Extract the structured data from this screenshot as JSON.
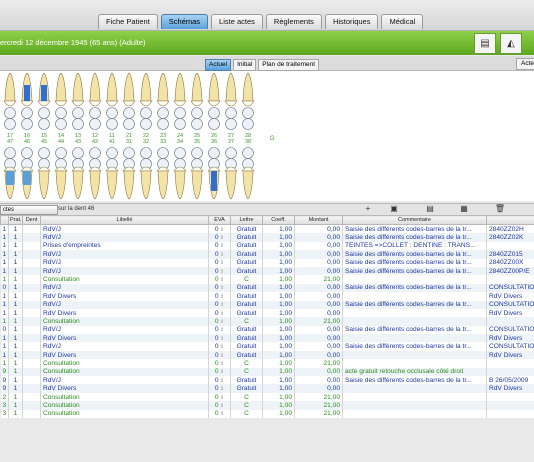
{
  "tabs": [
    "Fiche Patient",
    "Schémas",
    "Liste actes",
    "Règlements",
    "Historiques",
    "Médical"
  ],
  "active_tab": "Schémas",
  "patient_line": "ercredi 12 décembre 1945 (65 ans)  (Adulte)",
  "subtabs": [
    "Actuel",
    "Initial",
    "Plan de traitement"
  ],
  "active_subtab": "Actuel",
  "acte_button": "Acte",
  "upper_numbers": [
    "17",
    "16",
    "15",
    "14",
    "13",
    "12",
    "11",
    "21",
    "22",
    "23",
    "24",
    "25",
    "26",
    "27",
    "28"
  ],
  "upper_numbers_row2": [
    "47",
    "46",
    "45",
    "44",
    "43",
    "42",
    "41",
    "31",
    "32",
    "33",
    "34",
    "35",
    "36",
    "37",
    "38"
  ],
  "quadrant_label": "G",
  "filter_select": "ctes",
  "filter_text": "sur la dent 46",
  "table_headers": [
    "Prat.",
    "Dent",
    "Libellé",
    "EVA",
    "Lettre",
    "Coeff.",
    "Montant",
    "Commentaire",
    ""
  ],
  "rows": [
    [
      "1",
      "1",
      "",
      "RdV/J",
      "0",
      "Gratuit",
      "1,00",
      "0,00",
      "Saisie des différents codes-barres de la tr...",
      "2840ZZ02H",
      "blue"
    ],
    [
      "1",
      "1",
      "",
      "RdV/J",
      "0",
      "Gratuit",
      "1,00",
      "0,00",
      "Saisie des différents codes-barres de la tr...",
      "2840ZZ02K",
      "blue"
    ],
    [
      "1",
      "1",
      "",
      "Prises d'empreintes",
      "0",
      "Gratuit",
      "1,00",
      "0,00",
      "TEINTES =>COLLET : DENTINE : TRANS...",
      "",
      "blue"
    ],
    [
      "1",
      "1",
      "",
      "RdV/J",
      "0",
      "Gratuit",
      "1,00",
      "0,00",
      "Saisie des différents codes-barres de la tr...",
      "2840ZZ015",
      "blue"
    ],
    [
      "1",
      "1",
      "",
      "RdV/J",
      "0",
      "Gratuit",
      "1,00",
      "0,00",
      "Saisie des différents codes-barres de la tr...",
      "2840ZZ00X",
      "blue"
    ],
    [
      "1",
      "1",
      "",
      "RdV/J",
      "0",
      "Gratuit",
      "1,00",
      "0,00",
      "Saisie des différents codes-barres de la tr...",
      "2840ZZ00P/E",
      "blue"
    ],
    [
      "1",
      "1",
      "",
      "Consultation",
      "0",
      "C",
      "1,00",
      "21,00",
      "",
      "",
      "green"
    ],
    [
      "0",
      "1",
      "",
      "RdV/J",
      "0",
      "Gratuit",
      "1,00",
      "0,00",
      "Saisie des différents codes-barres de la tr...",
      "CONSULTATION",
      "blue"
    ],
    [
      "1",
      "1",
      "",
      "RdV Divers",
      "0",
      "Gratuit",
      "1,00",
      "0,00",
      "",
      "RdV Divers",
      "blue"
    ],
    [
      "1",
      "1",
      "",
      "RdV/J",
      "0",
      "Gratuit",
      "1,00",
      "0,00",
      "Saisie des différents codes-barres de la tr...",
      "CONSULTATION",
      "blue"
    ],
    [
      "1",
      "1",
      "",
      "RdV Divers",
      "0",
      "Gratuit",
      "1,00",
      "0,00",
      "",
      "RdV Divers",
      "blue"
    ],
    [
      "1",
      "1",
      "",
      "Consultation",
      "0",
      "C",
      "1,00",
      "21,00",
      "",
      "",
      "green"
    ],
    [
      "0",
      "1",
      "",
      "RdV/J",
      "0",
      "Gratuit",
      "1,00",
      "0,00",
      "Saisie des différents codes-barres de la tr...",
      "CONSULTATION",
      "blue"
    ],
    [
      "1",
      "1",
      "",
      "RdV Divers",
      "0",
      "Gratuit",
      "1,00",
      "0,00",
      "",
      "RdV Divers",
      "blue"
    ],
    [
      "1",
      "1",
      "",
      "RdV/J",
      "0",
      "Gratuit",
      "1,00",
      "0,00",
      "Saisie des différents codes-barres de la tr...",
      "CONSULTATION",
      "blue"
    ],
    [
      "1",
      "1",
      "",
      "RdV Divers",
      "0",
      "Gratuit",
      "1,00",
      "0,00",
      "",
      "RdV Divers",
      "blue"
    ],
    [
      "1",
      "1",
      "",
      "Consultation",
      "0",
      "C",
      "1,00",
      "21,00",
      "",
      "",
      "green"
    ],
    [
      "9",
      "1",
      "",
      "Consultation",
      "0",
      "C",
      "1,00",
      "0,00",
      "acte gratuit retouche occlusale côté droit",
      "",
      "green"
    ],
    [
      "9",
      "1",
      "",
      "RdV/J",
      "0",
      "Gratuit",
      "1,00",
      "0,00",
      "Saisie des différents codes-barres de la tr...",
      "B 26/05/2009",
      "blue"
    ],
    [
      "9",
      "1",
      "",
      "RdV Divers",
      "0",
      "Gratuit",
      "1,00",
      "0,00",
      "",
      "RdV Divers",
      "blue"
    ],
    [
      "2",
      "1",
      "",
      "Consultation",
      "0",
      "C",
      "1,00",
      "21,00",
      "",
      "",
      "green"
    ],
    [
      "3",
      "1",
      "",
      "Consultation",
      "0",
      "C",
      "1,00",
      "21,00",
      "",
      "",
      "green"
    ],
    [
      "3",
      "1",
      "",
      "Consultation",
      "0",
      "C",
      "1,00",
      "21,00",
      "",
      "",
      "green"
    ]
  ],
  "colors": {
    "green_bar": "#6cb52a",
    "tab_active": "#5aa2dc",
    "blue_text": "#1f3aa8",
    "green_text": "#2a8e1e"
  }
}
